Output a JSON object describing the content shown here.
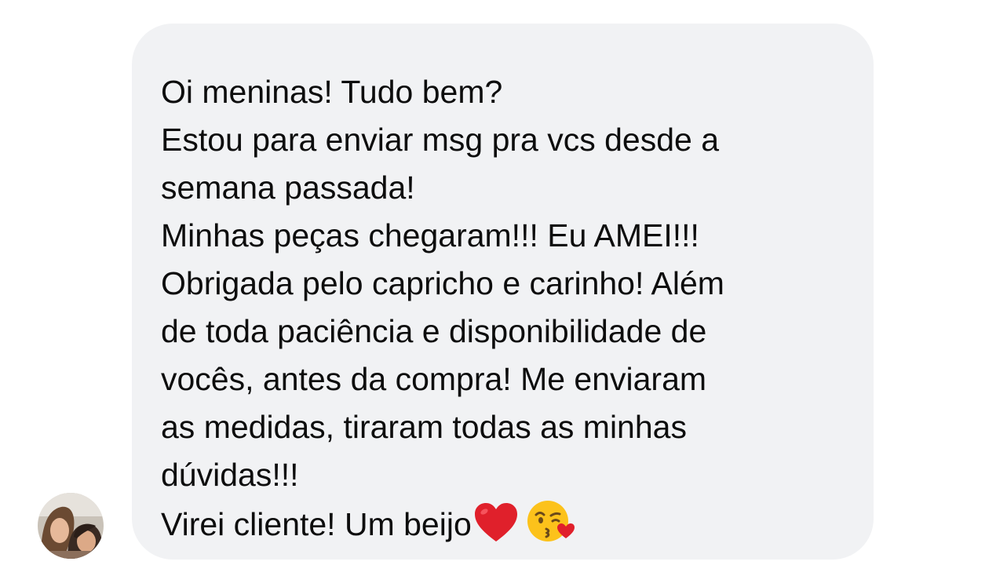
{
  "message": {
    "paragraphs": [
      "Oi meninas! Tudo bem?",
      "Estou para enviar msg pra vcs desde a\nsemana passada!",
      "Minhas peças chegaram!!! Eu AMEI!!!",
      "Obrigada pelo capricho e carinho! Além\nde toda paciência e disponibilidade de\nvocês, antes da compra! Me enviaram\nas medidas, tiraram todas as minhas\ndúvidas!!!"
    ],
    "closing_text": "Virei cliente! Um beijo",
    "emojis": [
      "heart-icon",
      "kissing-face-icon"
    ]
  },
  "sender": {
    "avatar": "sender-avatar-photo"
  }
}
